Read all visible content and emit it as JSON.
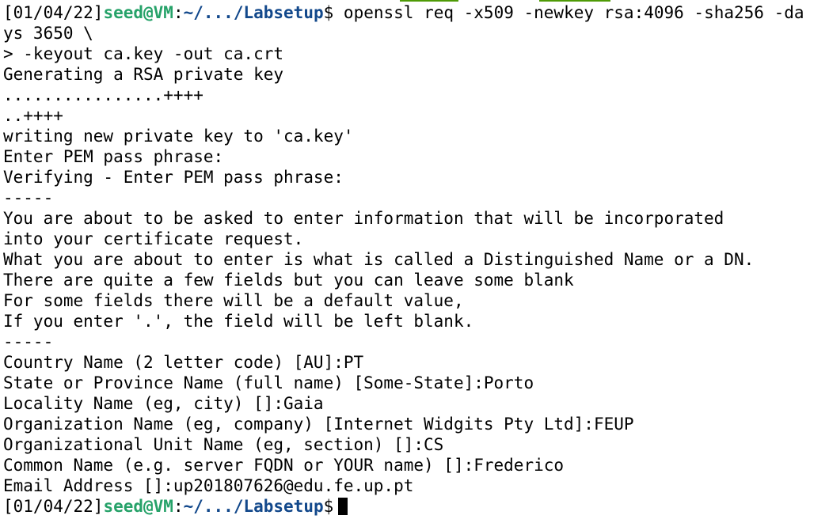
{
  "colors": {
    "background": "#ffffff",
    "text": "#000000",
    "prompt_user": "#26a269",
    "prompt_path": "#12488b",
    "tab_accent": "#4e9a06"
  },
  "prompts": [
    {
      "date": "[01/04/22]",
      "user": "seed@VM",
      "sep": ":",
      "path": "~/.../Labsetup",
      "sign": "$",
      "command": " openssl req -x509 -newkey rsa:4096 -sha256 -da"
    },
    {
      "date": "[01/04/22]",
      "user": "seed@VM",
      "sep": ":",
      "path": "~/.../Labsetup",
      "sign": "$",
      "command": " "
    }
  ],
  "output_lines": [
    "ys 3650 \\",
    "> -keyout ca.key -out ca.crt",
    "Generating a RSA private key",
    "................++++",
    "..++++",
    "writing new private key to 'ca.key'",
    "Enter PEM pass phrase:",
    "Verifying - Enter PEM pass phrase:",
    "-----",
    "You are about to be asked to enter information that will be incorporated",
    "into your certificate request.",
    "What you are about to enter is what is called a Distinguished Name or a DN.",
    "There are quite a few fields but you can leave some blank",
    "For some fields there will be a default value,",
    "If you enter '.', the field will be left blank.",
    "-----",
    "Country Name (2 letter code) [AU]:PT",
    "State or Province Name (full name) [Some-State]:Porto",
    "Locality Name (eg, city) []:Gaia",
    "Organization Name (eg, company) [Internet Widgits Pty Ltd]:FEUP",
    "Organizational Unit Name (eg, section) []:CS",
    "Common Name (e.g. server FQDN or YOUR name) []:Frederico",
    "Email Address []:up201807626@edu.fe.up.pt"
  ]
}
